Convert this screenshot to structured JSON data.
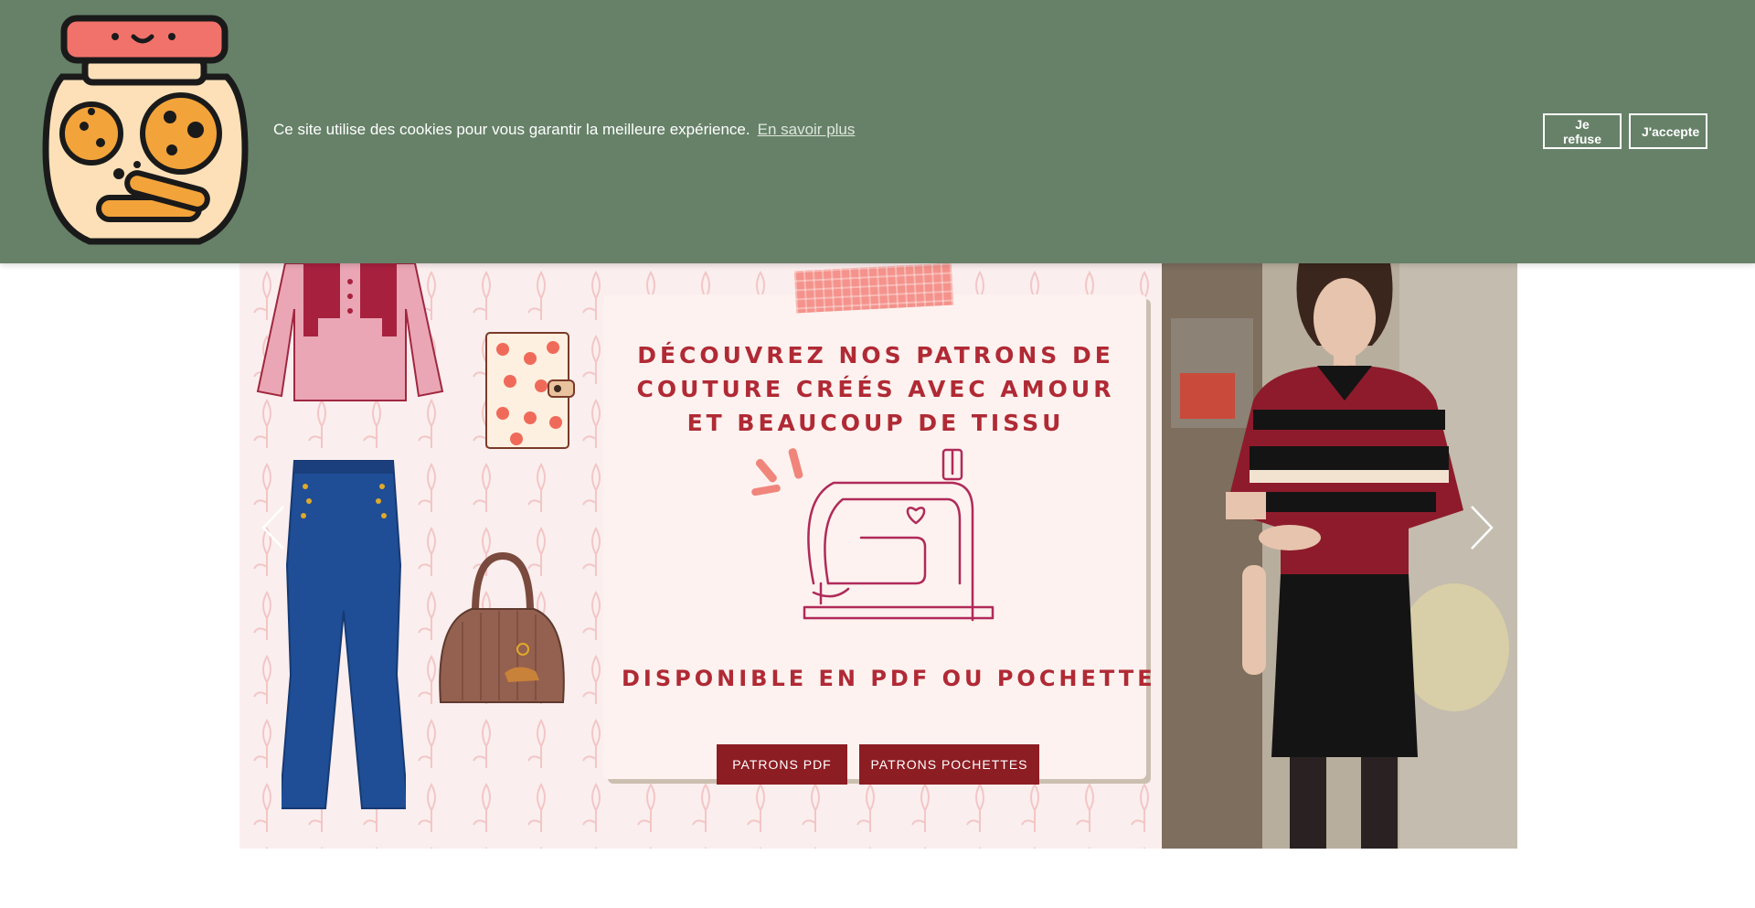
{
  "cookie_banner": {
    "message": "Ce site utilise des cookies pour vous garantir la meilleure expérience.",
    "learn_more": "En savoir plus",
    "refuse_label": "Je refuse",
    "accept_label": "J'accepte",
    "background": "#668168"
  },
  "hero": {
    "headline": "DÉCOUVREZ NOS PATRONS DE COUTURE CRÉÉS AVEC AMOUR ET BEAUCOUP DE TISSU",
    "subline": "DISPONIBLE EN PDF OU POCHETTE",
    "buttons": {
      "pdf": "PATRONS PDF",
      "pochettes": "PATRONS POCHETTES"
    },
    "accent_color": "#b02a35",
    "button_color": "#8c1d23",
    "icons": [
      "chevron-left-icon",
      "chevron-right-icon",
      "sewing-machine-icon",
      "cookie-jar-icon"
    ]
  }
}
